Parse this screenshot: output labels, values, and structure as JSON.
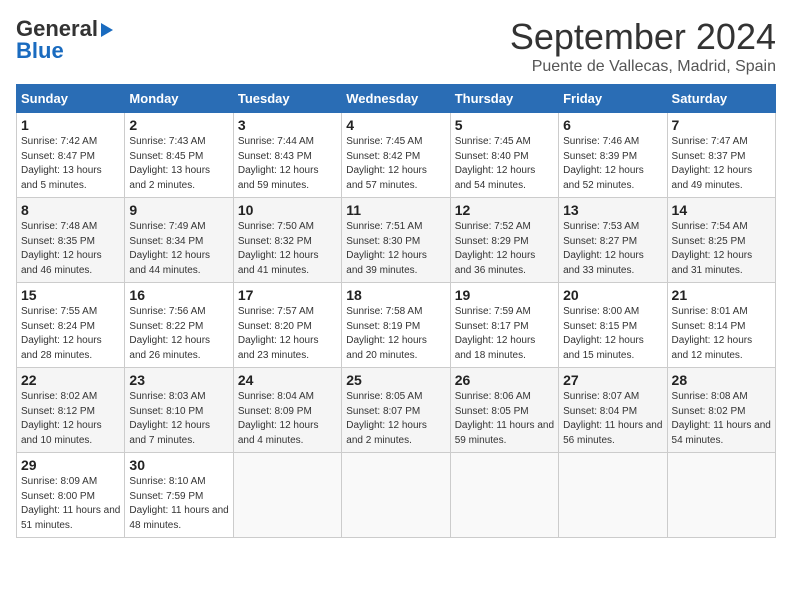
{
  "header": {
    "logo_general": "General",
    "logo_blue": "Blue",
    "month_title": "September 2024",
    "location": "Puente de Vallecas, Madrid, Spain"
  },
  "weekdays": [
    "Sunday",
    "Monday",
    "Tuesday",
    "Wednesday",
    "Thursday",
    "Friday",
    "Saturday"
  ],
  "weeks": [
    [
      {
        "day": "1",
        "sunrise": "7:42 AM",
        "sunset": "8:47 PM",
        "daylight": "13 hours and 5 minutes."
      },
      {
        "day": "2",
        "sunrise": "7:43 AM",
        "sunset": "8:45 PM",
        "daylight": "13 hours and 2 minutes."
      },
      {
        "day": "3",
        "sunrise": "7:44 AM",
        "sunset": "8:43 PM",
        "daylight": "12 hours and 59 minutes."
      },
      {
        "day": "4",
        "sunrise": "7:45 AM",
        "sunset": "8:42 PM",
        "daylight": "12 hours and 57 minutes."
      },
      {
        "day": "5",
        "sunrise": "7:45 AM",
        "sunset": "8:40 PM",
        "daylight": "12 hours and 54 minutes."
      },
      {
        "day": "6",
        "sunrise": "7:46 AM",
        "sunset": "8:39 PM",
        "daylight": "12 hours and 52 minutes."
      },
      {
        "day": "7",
        "sunrise": "7:47 AM",
        "sunset": "8:37 PM",
        "daylight": "12 hours and 49 minutes."
      }
    ],
    [
      {
        "day": "8",
        "sunrise": "7:48 AM",
        "sunset": "8:35 PM",
        "daylight": "12 hours and 46 minutes."
      },
      {
        "day": "9",
        "sunrise": "7:49 AM",
        "sunset": "8:34 PM",
        "daylight": "12 hours and 44 minutes."
      },
      {
        "day": "10",
        "sunrise": "7:50 AM",
        "sunset": "8:32 PM",
        "daylight": "12 hours and 41 minutes."
      },
      {
        "day": "11",
        "sunrise": "7:51 AM",
        "sunset": "8:30 PM",
        "daylight": "12 hours and 39 minutes."
      },
      {
        "day": "12",
        "sunrise": "7:52 AM",
        "sunset": "8:29 PM",
        "daylight": "12 hours and 36 minutes."
      },
      {
        "day": "13",
        "sunrise": "7:53 AM",
        "sunset": "8:27 PM",
        "daylight": "12 hours and 33 minutes."
      },
      {
        "day": "14",
        "sunrise": "7:54 AM",
        "sunset": "8:25 PM",
        "daylight": "12 hours and 31 minutes."
      }
    ],
    [
      {
        "day": "15",
        "sunrise": "7:55 AM",
        "sunset": "8:24 PM",
        "daylight": "12 hours and 28 minutes."
      },
      {
        "day": "16",
        "sunrise": "7:56 AM",
        "sunset": "8:22 PM",
        "daylight": "12 hours and 26 minutes."
      },
      {
        "day": "17",
        "sunrise": "7:57 AM",
        "sunset": "8:20 PM",
        "daylight": "12 hours and 23 minutes."
      },
      {
        "day": "18",
        "sunrise": "7:58 AM",
        "sunset": "8:19 PM",
        "daylight": "12 hours and 20 minutes."
      },
      {
        "day": "19",
        "sunrise": "7:59 AM",
        "sunset": "8:17 PM",
        "daylight": "12 hours and 18 minutes."
      },
      {
        "day": "20",
        "sunrise": "8:00 AM",
        "sunset": "8:15 PM",
        "daylight": "12 hours and 15 minutes."
      },
      {
        "day": "21",
        "sunrise": "8:01 AM",
        "sunset": "8:14 PM",
        "daylight": "12 hours and 12 minutes."
      }
    ],
    [
      {
        "day": "22",
        "sunrise": "8:02 AM",
        "sunset": "8:12 PM",
        "daylight": "12 hours and 10 minutes."
      },
      {
        "day": "23",
        "sunrise": "8:03 AM",
        "sunset": "8:10 PM",
        "daylight": "12 hours and 7 minutes."
      },
      {
        "day": "24",
        "sunrise": "8:04 AM",
        "sunset": "8:09 PM",
        "daylight": "12 hours and 4 minutes."
      },
      {
        "day": "25",
        "sunrise": "8:05 AM",
        "sunset": "8:07 PM",
        "daylight": "12 hours and 2 minutes."
      },
      {
        "day": "26",
        "sunrise": "8:06 AM",
        "sunset": "8:05 PM",
        "daylight": "11 hours and 59 minutes."
      },
      {
        "day": "27",
        "sunrise": "8:07 AM",
        "sunset": "8:04 PM",
        "daylight": "11 hours and 56 minutes."
      },
      {
        "day": "28",
        "sunrise": "8:08 AM",
        "sunset": "8:02 PM",
        "daylight": "11 hours and 54 minutes."
      }
    ],
    [
      {
        "day": "29",
        "sunrise": "8:09 AM",
        "sunset": "8:00 PM",
        "daylight": "11 hours and 51 minutes."
      },
      {
        "day": "30",
        "sunrise": "8:10 AM",
        "sunset": "7:59 PM",
        "daylight": "11 hours and 48 minutes."
      },
      null,
      null,
      null,
      null,
      null
    ]
  ]
}
